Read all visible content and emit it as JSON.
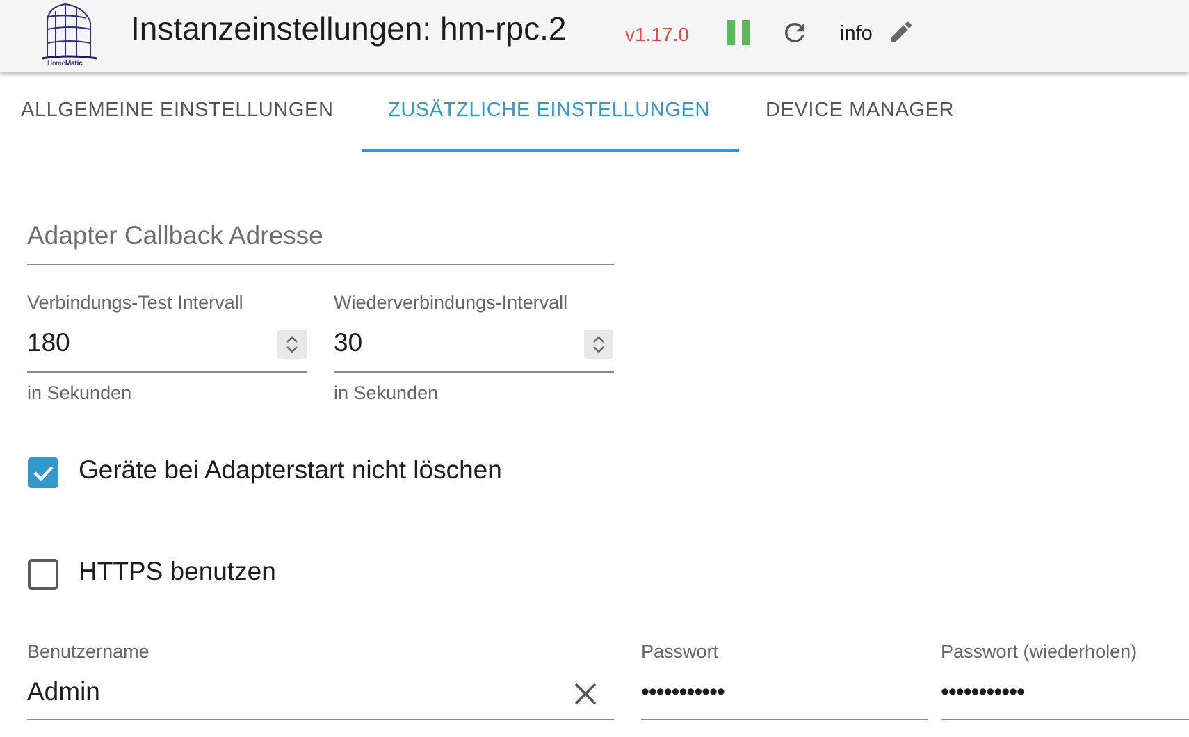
{
  "header": {
    "logo_text_home": "Home",
    "logo_text_matic": "Matic",
    "title": "Instanzeinstellungen: hm-rpc.2",
    "version": "v1.17.0",
    "info_label": "info",
    "icons": [
      "homematic-logo",
      "pause-icon",
      "reload-icon",
      "edit-icon"
    ],
    "colors": {
      "version": "#e04b4b",
      "pause": "#5cb85c",
      "accent": "#3399cc"
    }
  },
  "tabs": [
    {
      "label": "ALLGEMEINE EINSTELLUNGEN",
      "active": false
    },
    {
      "label": "ZUSÄTZLICHE EINSTELLUNGEN",
      "active": true
    },
    {
      "label": "DEVICE MANAGER",
      "active": false
    }
  ],
  "form": {
    "callback": {
      "placeholder": "Adapter Callback Adresse",
      "value": ""
    },
    "test_interval": {
      "label": "Verbindungs-Test Intervall",
      "value": "180",
      "helper": "in Sekunden"
    },
    "reconnect_interval": {
      "label": "Wiederverbindungs-Intervall",
      "value": "30",
      "helper": "in Sekunden"
    },
    "dont_delete": {
      "label": "Geräte bei Adapterstart nicht löschen",
      "checked": true
    },
    "use_https": {
      "label": "HTTPS benutzen",
      "checked": false
    },
    "username": {
      "label": "Benutzername",
      "value": "Admin"
    },
    "password": {
      "label": "Passwort",
      "masked": "•••••••••••"
    },
    "password_repeat": {
      "label": "Passwort (wiederholen)",
      "masked": "•••••••••••"
    }
  }
}
